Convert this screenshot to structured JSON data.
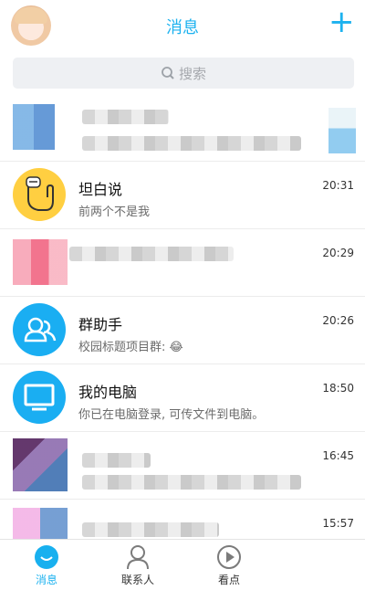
{
  "header": {
    "title": "消息",
    "add_icon": "plus-icon"
  },
  "search": {
    "placeholder": "搜索"
  },
  "conversations": [
    {
      "name": "",
      "preview": "",
      "time": ""
    },
    {
      "name": "坦白说",
      "preview": "前两个不是我",
      "time": "20:31"
    },
    {
      "name": "",
      "preview": "",
      "time": "20:29"
    },
    {
      "name": "群助手",
      "preview": "校园标题项目群: 😂",
      "time": "20:26"
    },
    {
      "name": "我的电脑",
      "preview": "你已在电脑登录, 可传文件到电脑。",
      "time": "18:50"
    },
    {
      "name": "",
      "preview": "",
      "time": "16:45"
    },
    {
      "name": "",
      "preview": "",
      "time": "15:57"
    }
  ],
  "tabs": [
    {
      "label": "消息",
      "active": true
    },
    {
      "label": "联系人",
      "active": false
    },
    {
      "label": "看点",
      "active": false
    }
  ],
  "colors": {
    "accent": "#1db2ef"
  }
}
